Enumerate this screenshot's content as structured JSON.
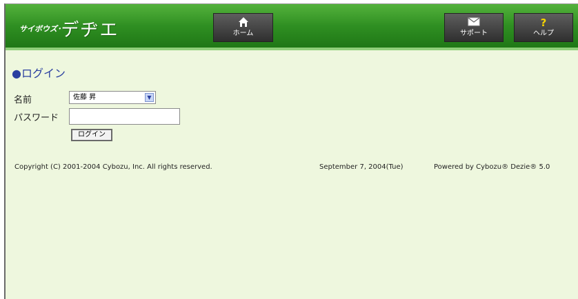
{
  "header": {
    "logo_small": "サイボウズ･",
    "logo_big": "デヂエ",
    "home_label": "ホーム",
    "support_label": "サポート",
    "help_label": "ヘルプ",
    "help_icon": "?",
    "accent": "#2f8f22"
  },
  "login": {
    "title_bullet": "●",
    "title": "ログイン",
    "name_label": "名前",
    "name_value": "佐藤 昇",
    "password_label": "パスワード",
    "password_value": "",
    "login_button": "ログイン"
  },
  "footer": {
    "copyright": "Copyright (C) 2001-2004 Cybozu, Inc. All rights reserved.",
    "date": "September 7, 2004(Tue)",
    "powered": "Powered by Cybozu® Dezie® 5.0"
  }
}
